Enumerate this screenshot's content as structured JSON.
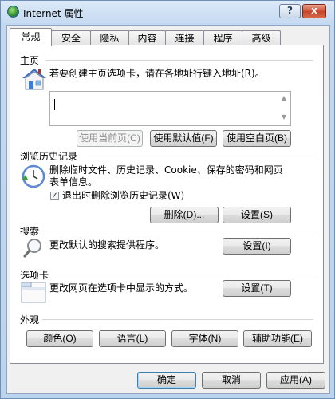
{
  "window": {
    "title": "Internet 属性"
  },
  "titlebar": {
    "help_label": "?",
    "close_label": "x"
  },
  "tabs": [
    {
      "label": "常规",
      "active": true
    },
    {
      "label": "安全"
    },
    {
      "label": "隐私"
    },
    {
      "label": "内容"
    },
    {
      "label": "连接"
    },
    {
      "label": "程序"
    },
    {
      "label": "高级"
    }
  ],
  "homepage": {
    "heading": "主页",
    "description": "若要创建主页选项卡，请在各地址行键入地址(R)。",
    "address_value": "",
    "buttons": {
      "use_current": "使用当前页(C)",
      "use_default": "使用默认值(F)",
      "use_blank": "使用空白页(B)"
    },
    "icon": "house-icon"
  },
  "history": {
    "heading": "浏览历史记录",
    "description_line1": "删除临时文件、历史记录、Cookie、保存的密码和网页",
    "description_line2": "表单信息。",
    "checkbox_label": "退出时删除浏览历史记录(W)",
    "checkbox_checked": true,
    "buttons": {
      "delete": "删除(D)...",
      "settings": "设置(S)"
    },
    "icon": "history-clock-icon"
  },
  "search": {
    "heading": "搜索",
    "description": "更改默认的搜索提供程序。",
    "button": "设置(I)",
    "icon": "magnifier-icon"
  },
  "tabs_section": {
    "heading": "选项卡",
    "description": "更改网页在选项卡中显示的方式。",
    "button": "设置(T)",
    "icon": "tab-window-icon"
  },
  "appearance": {
    "heading": "外观",
    "buttons": {
      "colors": "颜色(O)",
      "languages": "语言(L)",
      "fonts": "字体(N)",
      "accessibility": "辅助功能(E)"
    }
  },
  "dialog_buttons": {
    "ok": "确定",
    "cancel": "取消",
    "apply": "应用(A)"
  }
}
